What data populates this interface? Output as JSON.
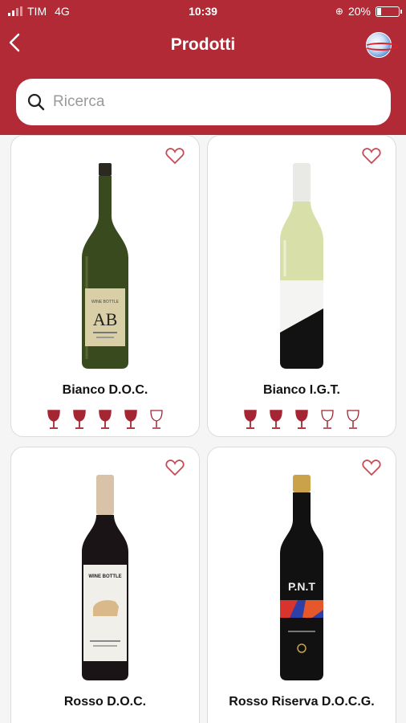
{
  "status": {
    "carrier": "TIM",
    "network": "4G",
    "time": "10:39",
    "battery": "20%"
  },
  "header": {
    "title": "Prodotti",
    "back_icon": "chevron-left-icon",
    "logo_icon": "globe-logo-icon"
  },
  "search": {
    "placeholder": "Ricerca",
    "value": ""
  },
  "colors": {
    "brand": "#b22a36",
    "glass_filled": "#a52632",
    "heart": "#c84a55"
  },
  "products": [
    {
      "name": "Bianco D.O.C.",
      "rating": 4,
      "max_rating": 5
    },
    {
      "name": "Bianco I.G.T.",
      "rating": 3,
      "max_rating": 5
    },
    {
      "name": "Rosso D.O.C."
    },
    {
      "name": "Rosso Riserva D.O.C.G."
    }
  ]
}
